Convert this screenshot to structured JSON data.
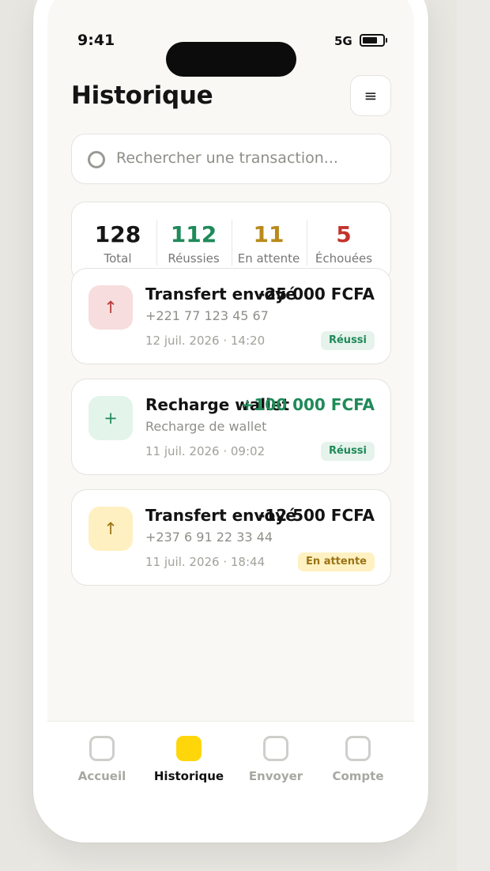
{
  "status_bar": {
    "time": "9:41",
    "network": "5G"
  },
  "header": {
    "title": "Historique",
    "menu_icon": "≡"
  },
  "search": {
    "placeholder": "Rechercher une transaction..."
  },
  "stats": [
    {
      "value": "128",
      "label": "Total",
      "color": "#151515"
    },
    {
      "value": "112",
      "label": "Réussies",
      "color": "#1f8a59"
    },
    {
      "value": "11",
      "label": "En attente",
      "color": "#b88a1b"
    },
    {
      "value": "5",
      "label": "Échouées",
      "color": "#c3342c"
    }
  ],
  "transactions": [
    {
      "name": "Transfert envoyé",
      "amount": "-25 000 FCFA",
      "amount_color": "#131313",
      "detail": "+221 77 123 45 67",
      "date": "12 juil. 2026 · 14:20",
      "status": "Réussi",
      "status_color": "#1f8a59",
      "status_bg": "#e6f3ec",
      "icon": "↑",
      "icon_color": "#b63b35",
      "icon_bg": "#f7dddd"
    },
    {
      "name": "Recharge wallet",
      "amount": "+100 000 FCFA",
      "amount_color": "#1f8a59",
      "detail": "Recharge de wallet",
      "date": "11 juil. 2026 · 09:02",
      "status": "Réussi",
      "status_color": "#1f8a59",
      "status_bg": "#e6f3ec",
      "icon": "+",
      "icon_color": "#1f8a59",
      "icon_bg": "#e3f4ea"
    },
    {
      "name": "Transfert envoyé",
      "amount": "-12 500 FCFA",
      "amount_color": "#131313",
      "detail": "+237 6 91 22 33 44",
      "date": "11 juil. 2026 · 18:44",
      "status": "En attente",
      "status_color": "#9b7314",
      "status_bg": "#fff1c2",
      "icon": "↑",
      "icon_color": "#9b7314",
      "icon_bg": "#fff0c1"
    }
  ],
  "nav": [
    {
      "label": "Accueil",
      "active": false
    },
    {
      "label": "Historique",
      "active": true
    },
    {
      "label": "Envoyer",
      "active": false
    },
    {
      "label": "Compte",
      "active": false
    }
  ],
  "colors": {
    "accent": "#ffd60a",
    "inactive_nav": "#cfcecb",
    "active_nav_text": "#111111"
  }
}
